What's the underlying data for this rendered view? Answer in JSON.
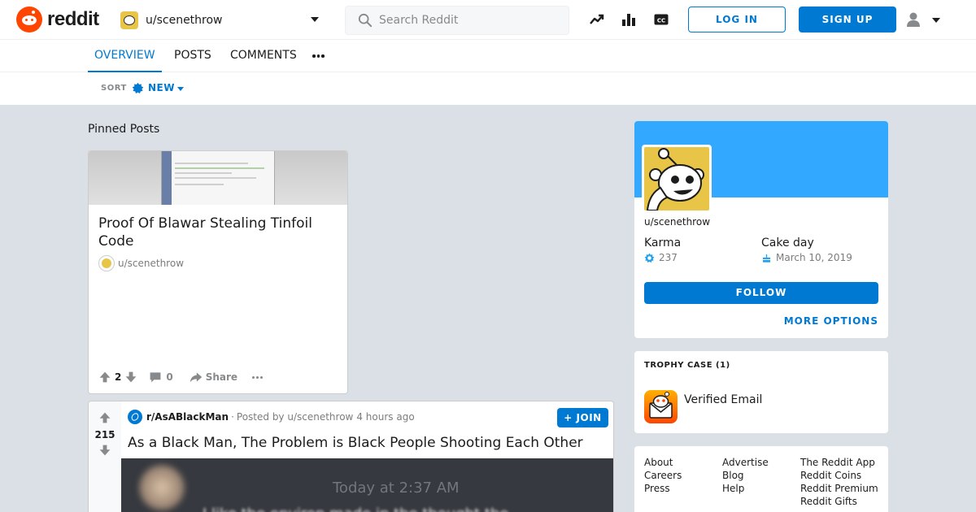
{
  "header": {
    "logo_text": "reddit",
    "current_user": "u/scenethrow",
    "search_placeholder": "Search Reddit",
    "login_label": "LOG IN",
    "signup_label": "SIGN UP"
  },
  "tabs": [
    {
      "label": "OVERVIEW",
      "active": true
    },
    {
      "label": "POSTS",
      "active": false
    },
    {
      "label": "COMMENTS",
      "active": false
    }
  ],
  "sort": {
    "label": "SORT",
    "value": "NEW"
  },
  "pinned": {
    "heading": "Pinned Posts",
    "post": {
      "title": "Proof Of Blawar Stealing Tinfoil Code",
      "author": "u/scenethrow",
      "votes": "2",
      "comments": "0",
      "share_label": "Share"
    }
  },
  "post": {
    "votes": "215",
    "subreddit": "r/AsABlackMan",
    "posted_by": "Posted by u/scenethrow",
    "time_ago": "4 hours ago",
    "join_label": "JOIN",
    "title": "As a Black Man, The Problem is Black People Shooting Each Other",
    "image_timestamp": "Today at 2:37 AM",
    "image_text": "I like the environ made in the thought the"
  },
  "profile": {
    "username": "u/scenethrow",
    "karma_label": "Karma",
    "karma_value": "237",
    "cakeday_label": "Cake day",
    "cakeday_value": "March 10, 2019",
    "follow_label": "FOLLOW",
    "more_options_label": "MORE OPTIONS"
  },
  "trophy_case": {
    "heading": "TROPHY CASE (1)",
    "trophies": [
      {
        "name": "Verified Email"
      }
    ]
  },
  "footer": {
    "col1": [
      "About",
      "Careers",
      "Press"
    ],
    "col2": [
      "Advertise",
      "Blog",
      "Help"
    ],
    "col3": [
      "The Reddit App",
      "Reddit Coins",
      "Reddit Premium",
      "Reddit Gifts"
    ]
  },
  "colors": {
    "accent": "#0079d3",
    "brand": "#ff4500",
    "banner": "#33a8ff",
    "page_bg": "#dae0e6"
  },
  "icons": [
    "reddit-logo-icon",
    "search-icon",
    "trending-icon",
    "stats-icon",
    "closed-caption-icon",
    "user-icon",
    "chevron-down-icon",
    "upvote-icon",
    "downvote-icon",
    "comment-icon",
    "share-icon",
    "more-icon",
    "karma-icon",
    "cake-icon",
    "verified-email-trophy-icon"
  ]
}
